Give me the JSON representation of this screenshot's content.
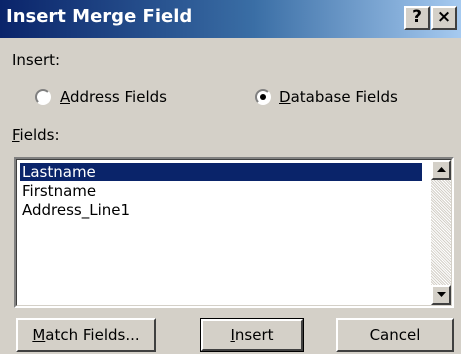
{
  "window": {
    "title": "Insert Merge Field",
    "help_label": "?",
    "close_label": "×"
  },
  "insert": {
    "label": "Insert:",
    "options": [
      {
        "label": "Address Fields",
        "underline_char": "A",
        "selected": false
      },
      {
        "label": "Database Fields",
        "underline_char": "D",
        "selected": true
      }
    ]
  },
  "fields": {
    "label": "Fields:",
    "items": [
      "Lastname",
      "Firstname",
      "Address_Line1"
    ],
    "selected_index": 0
  },
  "buttons": {
    "match_fields": "Match Fields...",
    "insert": "Insert",
    "cancel": "Cancel"
  },
  "icons": {
    "scroll_up": "arrow-up-icon",
    "scroll_down": "arrow-down-icon"
  },
  "colors": {
    "title_start": "#0a246a",
    "title_end": "#a6caf0",
    "selection": "#0a246a",
    "face": "#d4d0c8"
  }
}
